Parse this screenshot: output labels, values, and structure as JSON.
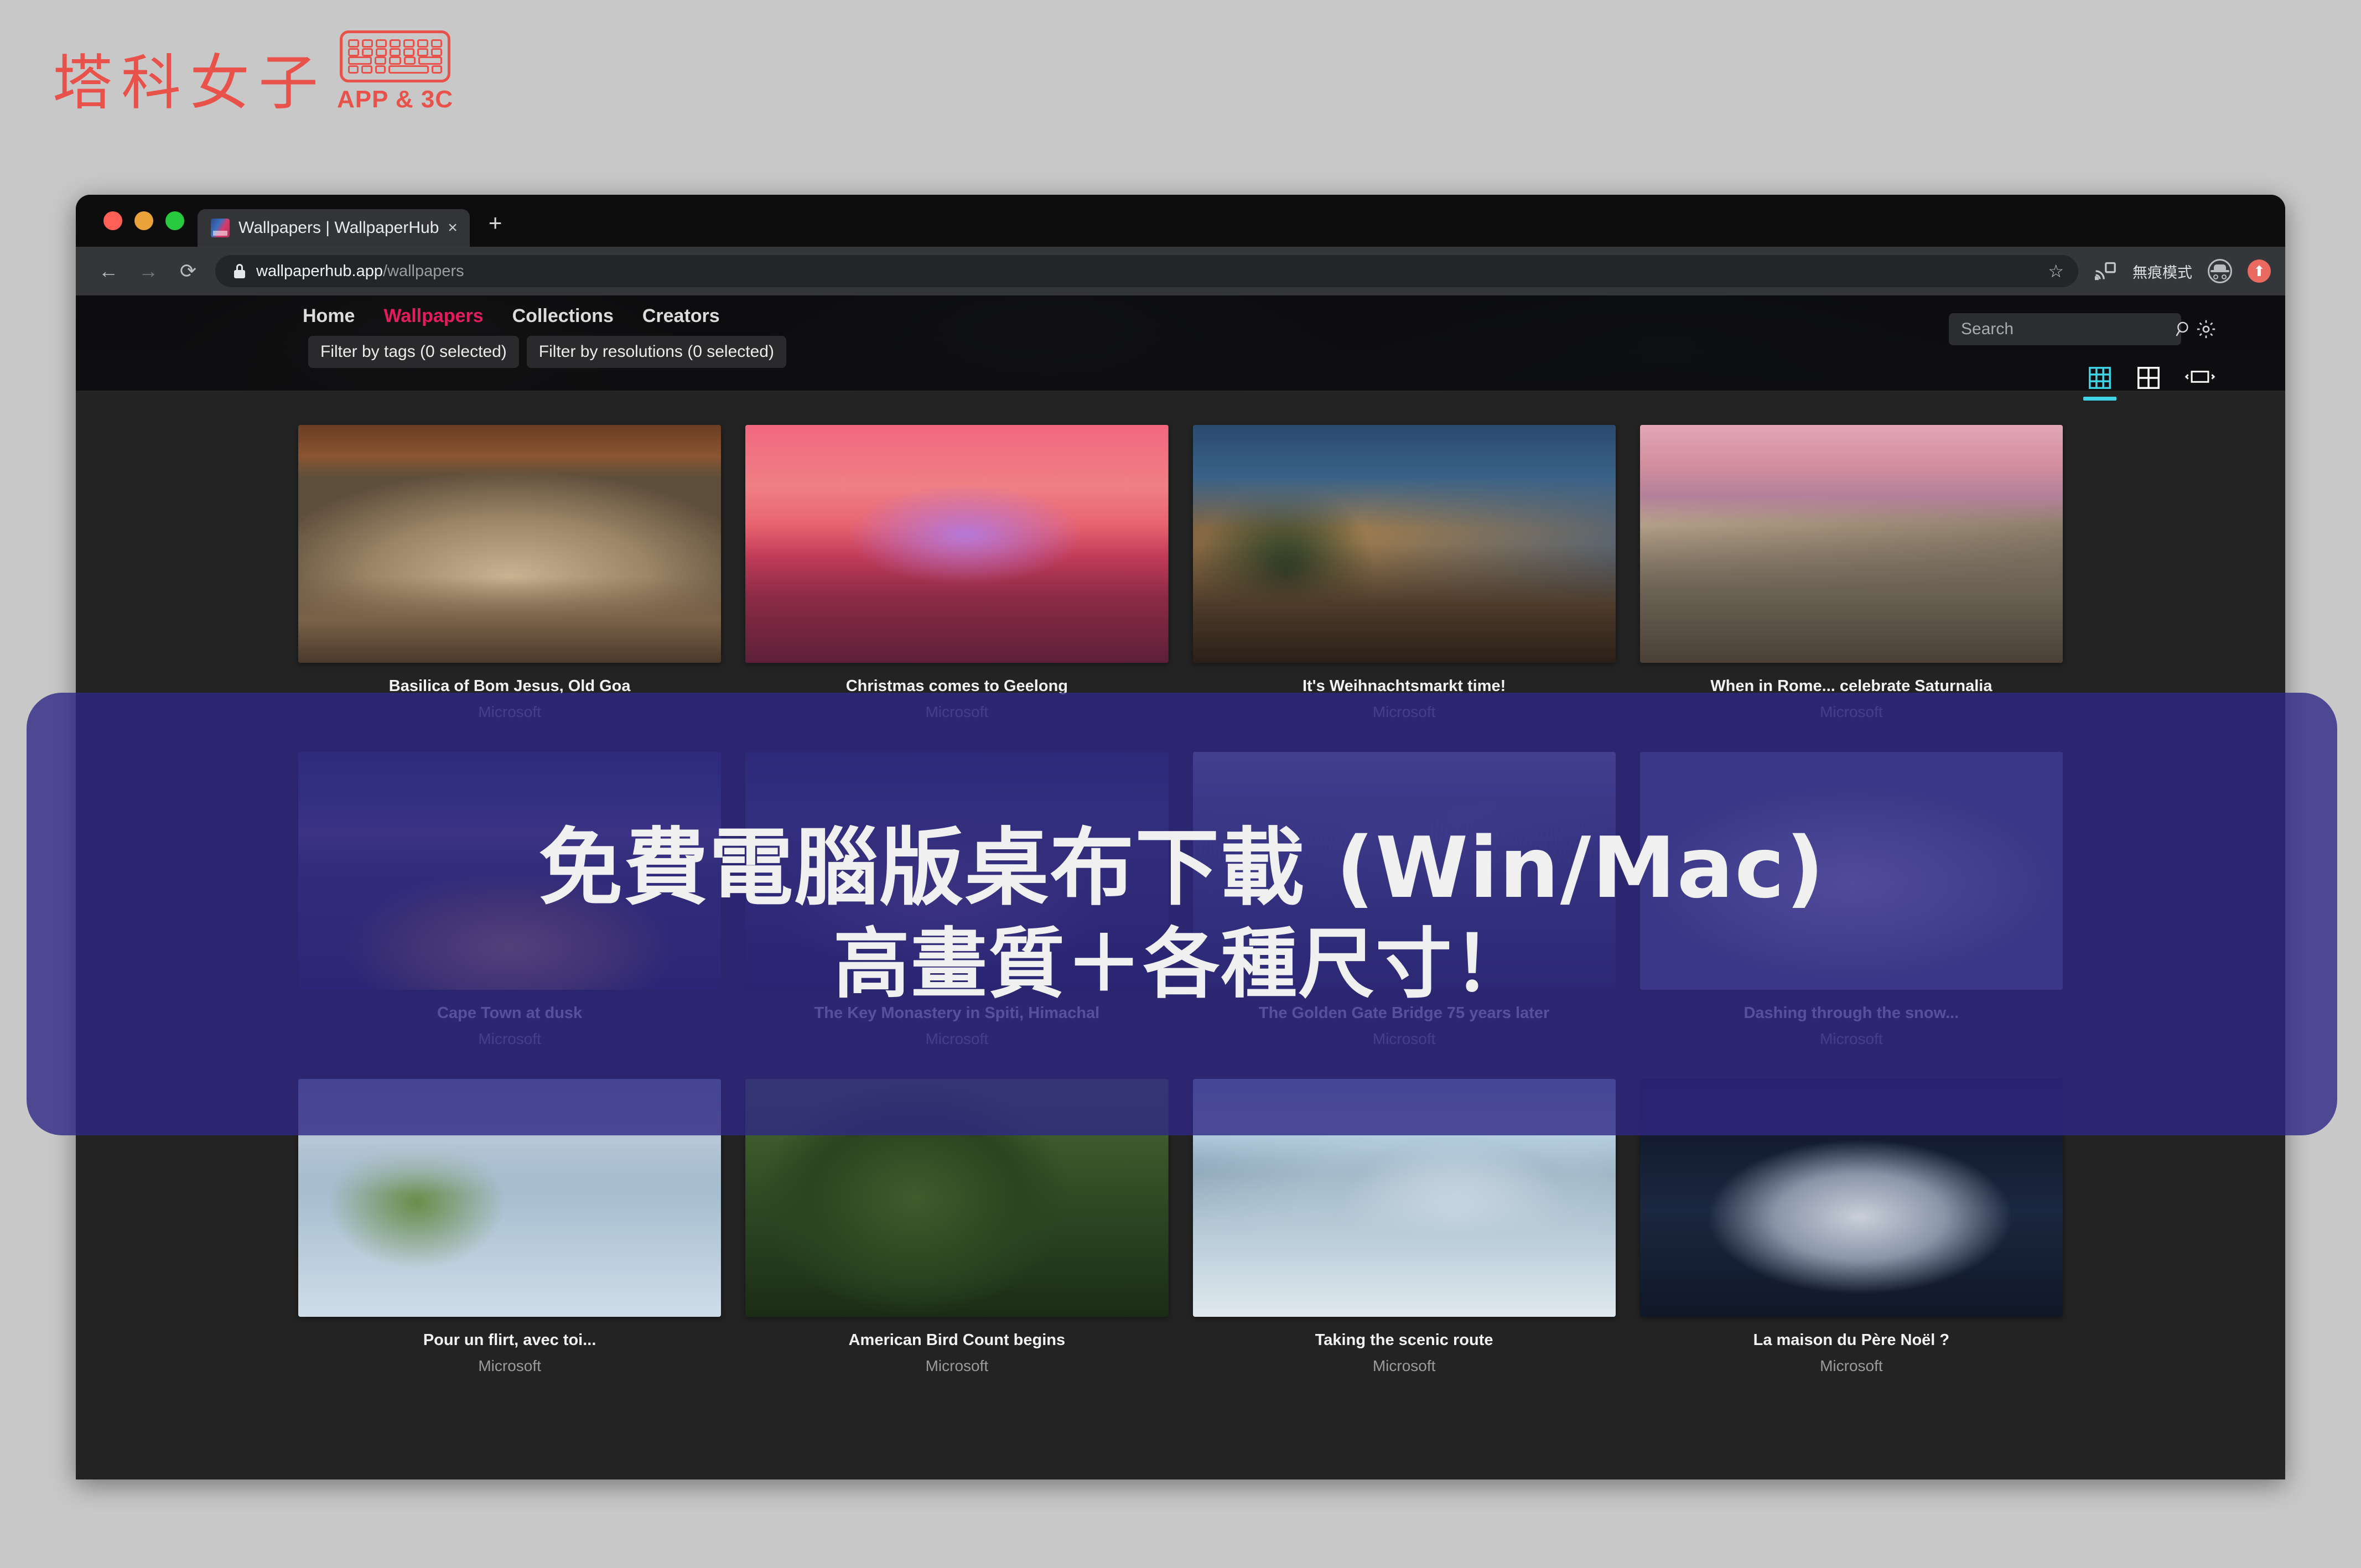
{
  "logo": {
    "text_cn": "塔科女子",
    "subtitle": "APP & 3C",
    "color": "#e8524a"
  },
  "browser": {
    "tab": {
      "title": "Wallpapers | WallpaperHub",
      "close_label": "×",
      "new_tab_label": "+"
    },
    "toolbar": {
      "back_label": "←",
      "forward_label": "→",
      "reload_label": "⟳",
      "url_domain": "wallpaperhub.app",
      "url_path": "/wallpapers",
      "star_label": "☆",
      "incognito_label": "無痕模式",
      "update_badge_label": "⬆"
    }
  },
  "site": {
    "nav": [
      {
        "label": "Home",
        "active": false
      },
      {
        "label": "Wallpapers",
        "active": true
      },
      {
        "label": "Collections",
        "active": false
      },
      {
        "label": "Creators",
        "active": false
      }
    ],
    "active_color": "#e31c5f",
    "search": {
      "placeholder": "Search",
      "value": ""
    },
    "filters": [
      "Filter by tags (0 selected)",
      "Filter by resolutions (0 selected)"
    ],
    "view_modes": [
      {
        "name": "grid-3x3",
        "active": true
      },
      {
        "name": "grid-2x2",
        "active": false
      },
      {
        "name": "wide-single",
        "active": false
      }
    ],
    "active_view_color": "#3fd4e6",
    "wallpapers": [
      {
        "title": "Basilica of Bom Jesus, Old Goa",
        "author": "Microsoft"
      },
      {
        "title": "Christmas comes to Geelong",
        "author": "Microsoft"
      },
      {
        "title": "It's Weihnachtsmarkt time!",
        "author": "Microsoft"
      },
      {
        "title": "When in Rome... celebrate Saturnalia",
        "author": "Microsoft"
      },
      {
        "title": "Cape Town at dusk",
        "author": "Microsoft"
      },
      {
        "title": "The Key Monastery in Spiti, Himachal",
        "author": "Microsoft"
      },
      {
        "title": "The Golden Gate Bridge 75 years later",
        "author": "Microsoft"
      },
      {
        "title": "Dashing through the snow...",
        "author": "Microsoft"
      },
      {
        "title": "Pour un flirt, avec toi...",
        "author": "Microsoft"
      },
      {
        "title": "American Bird Count begins",
        "author": "Microsoft"
      },
      {
        "title": "Taking the scenic route",
        "author": "Microsoft"
      },
      {
        "title": "La maison du Père Noël ?",
        "author": "Microsoft"
      }
    ]
  },
  "overlay": {
    "line1": "免費電腦版桌布下載 (Win/Mac)",
    "line2": "高畫質＋各種尺寸！",
    "background_color": "#2f2885",
    "text_color": "#f0f0f0"
  }
}
